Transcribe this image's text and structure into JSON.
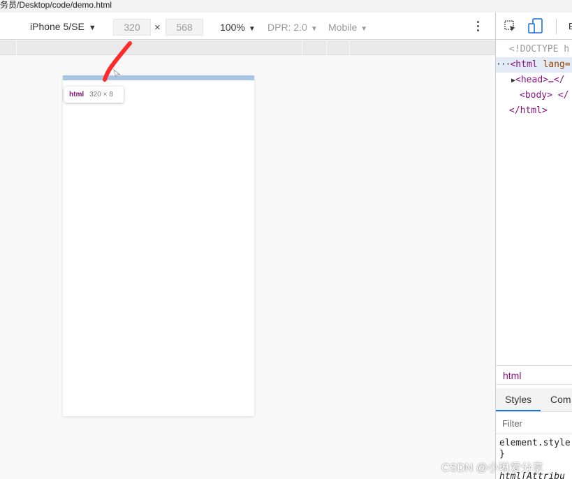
{
  "address_bar": {
    "path_text": "务员/Desktop/code/demo.html"
  },
  "device_toolbar": {
    "device": "iPhone 5/SE",
    "width": "320",
    "times": "×",
    "height": "568",
    "zoom": "100%",
    "dpr": "DPR: 2.0",
    "mode": "Mobile"
  },
  "viewport": {
    "tooltip_tag": "html",
    "tooltip_size": "320 × 8",
    "annotation_color": "#ff2a2a",
    "highlight_color": "#a8c5e4"
  },
  "devtools": {
    "tab_label": "E",
    "dom_lines": [
      {
        "text": "<!DOCTYPE h"
      },
      {
        "prefix": "···",
        "tag_open": "<html",
        "attr": " lang="
      },
      {
        "toggle": "▶",
        "tag": "<head>…</"
      },
      {
        "tag": "<body> </"
      },
      {
        "tag": "</html>"
      }
    ],
    "breadcrumb": "html",
    "styles_tabs": [
      "Styles",
      "Com"
    ],
    "filter_placeholder": "Filter",
    "rule_lines": [
      "element.style",
      "}",
      "html[Attribu"
    ]
  },
  "watermark": "CSDN @小琳爱分享"
}
